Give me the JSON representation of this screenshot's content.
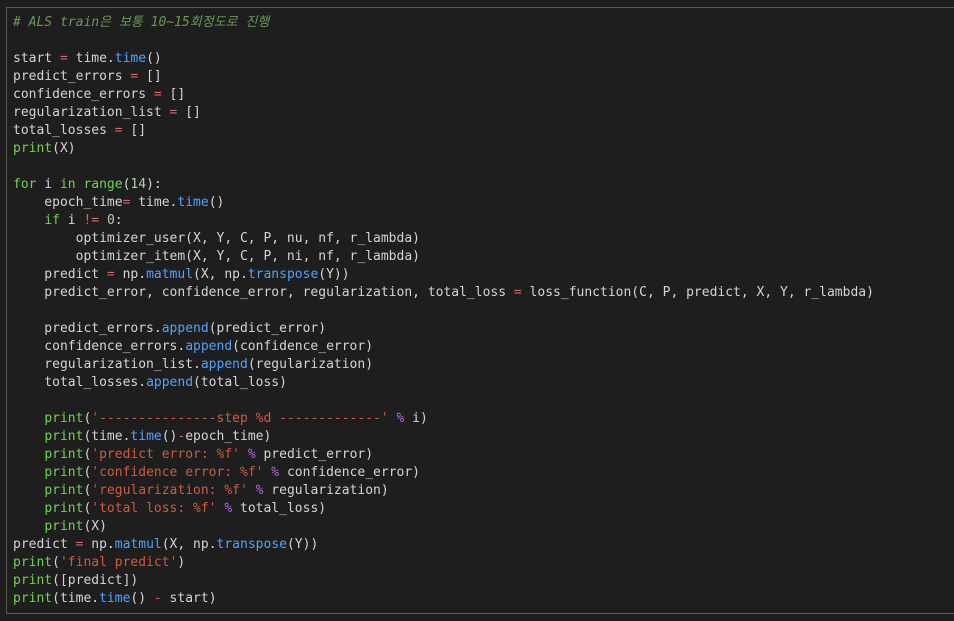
{
  "editor": {
    "lines": [
      [
        {
          "t": "# ALS train은 보통 10~15회정도로 진행",
          "c": "comment"
        }
      ],
      [],
      [
        {
          "t": "start ",
          "c": "var"
        },
        {
          "t": "=",
          "c": "op"
        },
        {
          "t": " time.",
          "c": "var"
        },
        {
          "t": "time",
          "c": "fn"
        },
        {
          "t": "()",
          "c": "plain"
        }
      ],
      [
        {
          "t": "predict_errors ",
          "c": "var"
        },
        {
          "t": "=",
          "c": "op"
        },
        {
          "t": " []",
          "c": "plain"
        }
      ],
      [
        {
          "t": "confidence_errors ",
          "c": "var"
        },
        {
          "t": "=",
          "c": "op"
        },
        {
          "t": " []",
          "c": "plain"
        }
      ],
      [
        {
          "t": "regularization_list ",
          "c": "var"
        },
        {
          "t": "=",
          "c": "op"
        },
        {
          "t": " []",
          "c": "plain"
        }
      ],
      [
        {
          "t": "total_losses ",
          "c": "var"
        },
        {
          "t": "=",
          "c": "op"
        },
        {
          "t": " []",
          "c": "plain"
        }
      ],
      [
        {
          "t": "print",
          "c": "builtin"
        },
        {
          "t": "(X)",
          "c": "plain"
        }
      ],
      [],
      [
        {
          "t": "for",
          "c": "ctrl"
        },
        {
          "t": " i ",
          "c": "var"
        },
        {
          "t": "in",
          "c": "ctrl"
        },
        {
          "t": " ",
          "c": "plain"
        },
        {
          "t": "range",
          "c": "builtin"
        },
        {
          "t": "(",
          "c": "plain"
        },
        {
          "t": "14",
          "c": "num"
        },
        {
          "t": "):",
          "c": "plain"
        }
      ],
      [
        {
          "t": "    epoch_time",
          "c": "var"
        },
        {
          "t": "=",
          "c": "op"
        },
        {
          "t": " time.",
          "c": "var"
        },
        {
          "t": "time",
          "c": "fn"
        },
        {
          "t": "()",
          "c": "plain"
        }
      ],
      [
        {
          "t": "    ",
          "c": "plain"
        },
        {
          "t": "if",
          "c": "ctrl"
        },
        {
          "t": " i ",
          "c": "var"
        },
        {
          "t": "!=",
          "c": "op"
        },
        {
          "t": " ",
          "c": "plain"
        },
        {
          "t": "0",
          "c": "num"
        },
        {
          "t": ":",
          "c": "plain"
        }
      ],
      [
        {
          "t": "        optimizer_user(X, Y, C, P, nu, nf, r_lambda)",
          "c": "var"
        }
      ],
      [
        {
          "t": "        optimizer_item(X, Y, C, P, ni, nf, r_lambda)",
          "c": "var"
        }
      ],
      [
        {
          "t": "    predict ",
          "c": "var"
        },
        {
          "t": "=",
          "c": "op"
        },
        {
          "t": " np.",
          "c": "var"
        },
        {
          "t": "matmul",
          "c": "fn"
        },
        {
          "t": "(X, np.",
          "c": "var"
        },
        {
          "t": "transpose",
          "c": "fn"
        },
        {
          "t": "(Y))",
          "c": "plain"
        }
      ],
      [
        {
          "t": "    predict_error, confidence_error, regularization, total_loss ",
          "c": "var"
        },
        {
          "t": "=",
          "c": "op"
        },
        {
          "t": " loss_function(C, P, predict, X, Y, r_lambda)",
          "c": "var"
        }
      ],
      [],
      [
        {
          "t": "    predict_errors.",
          "c": "var"
        },
        {
          "t": "append",
          "c": "fn"
        },
        {
          "t": "(predict_error)",
          "c": "plain"
        }
      ],
      [
        {
          "t": "    confidence_errors.",
          "c": "var"
        },
        {
          "t": "append",
          "c": "fn"
        },
        {
          "t": "(confidence_error)",
          "c": "plain"
        }
      ],
      [
        {
          "t": "    regularization_list.",
          "c": "var"
        },
        {
          "t": "append",
          "c": "fn"
        },
        {
          "t": "(regularization)",
          "c": "plain"
        }
      ],
      [
        {
          "t": "    total_losses.",
          "c": "var"
        },
        {
          "t": "append",
          "c": "fn"
        },
        {
          "t": "(total_loss)",
          "c": "plain"
        }
      ],
      [],
      [
        {
          "t": "    ",
          "c": "plain"
        },
        {
          "t": "print",
          "c": "builtin"
        },
        {
          "t": "(",
          "c": "plain"
        },
        {
          "t": "'---------------step %d -------------'",
          "c": "str"
        },
        {
          "t": " ",
          "c": "plain"
        },
        {
          "t": "%",
          "c": "opfmt"
        },
        {
          "t": " i)",
          "c": "plain"
        }
      ],
      [
        {
          "t": "    ",
          "c": "plain"
        },
        {
          "t": "print",
          "c": "builtin"
        },
        {
          "t": "(time.",
          "c": "plain"
        },
        {
          "t": "time",
          "c": "fn"
        },
        {
          "t": "()",
          "c": "plain"
        },
        {
          "t": "-",
          "c": "op"
        },
        {
          "t": "epoch_time)",
          "c": "plain"
        }
      ],
      [
        {
          "t": "    ",
          "c": "plain"
        },
        {
          "t": "print",
          "c": "builtin"
        },
        {
          "t": "(",
          "c": "plain"
        },
        {
          "t": "'predict error: %f'",
          "c": "str"
        },
        {
          "t": " ",
          "c": "plain"
        },
        {
          "t": "%",
          "c": "opfmt"
        },
        {
          "t": " predict_error)",
          "c": "plain"
        }
      ],
      [
        {
          "t": "    ",
          "c": "plain"
        },
        {
          "t": "print",
          "c": "builtin"
        },
        {
          "t": "(",
          "c": "plain"
        },
        {
          "t": "'confidence error: %f'",
          "c": "str"
        },
        {
          "t": " ",
          "c": "plain"
        },
        {
          "t": "%",
          "c": "opfmt"
        },
        {
          "t": " confidence_error)",
          "c": "plain"
        }
      ],
      [
        {
          "t": "    ",
          "c": "plain"
        },
        {
          "t": "print",
          "c": "builtin"
        },
        {
          "t": "(",
          "c": "plain"
        },
        {
          "t": "'regularization: %f'",
          "c": "str"
        },
        {
          "t": " ",
          "c": "plain"
        },
        {
          "t": "%",
          "c": "opfmt"
        },
        {
          "t": " regularization)",
          "c": "plain"
        }
      ],
      [
        {
          "t": "    ",
          "c": "plain"
        },
        {
          "t": "print",
          "c": "builtin"
        },
        {
          "t": "(",
          "c": "plain"
        },
        {
          "t": "'total loss: %f'",
          "c": "str"
        },
        {
          "t": " ",
          "c": "plain"
        },
        {
          "t": "%",
          "c": "opfmt"
        },
        {
          "t": " total_loss)",
          "c": "plain"
        }
      ],
      [
        {
          "t": "    ",
          "c": "plain"
        },
        {
          "t": "print",
          "c": "builtin"
        },
        {
          "t": "(X)",
          "c": "plain"
        }
      ],
      [
        {
          "t": "predict ",
          "c": "var"
        },
        {
          "t": "=",
          "c": "op"
        },
        {
          "t": " np.",
          "c": "var"
        },
        {
          "t": "matmul",
          "c": "fn"
        },
        {
          "t": "(X, np.",
          "c": "var"
        },
        {
          "t": "transpose",
          "c": "fn"
        },
        {
          "t": "(Y))",
          "c": "plain"
        }
      ],
      [
        {
          "t": "print",
          "c": "builtin"
        },
        {
          "t": "(",
          "c": "plain"
        },
        {
          "t": "'final predict'",
          "c": "str"
        },
        {
          "t": ")",
          "c": "plain"
        }
      ],
      [
        {
          "t": "print",
          "c": "builtin"
        },
        {
          "t": "([predict])",
          "c": "plain"
        }
      ],
      [
        {
          "t": "print",
          "c": "builtin"
        },
        {
          "t": "(time.",
          "c": "plain"
        },
        {
          "t": "time",
          "c": "fn"
        },
        {
          "t": "() ",
          "c": "plain"
        },
        {
          "t": "-",
          "c": "op"
        },
        {
          "t": " start)",
          "c": "plain"
        }
      ]
    ]
  }
}
